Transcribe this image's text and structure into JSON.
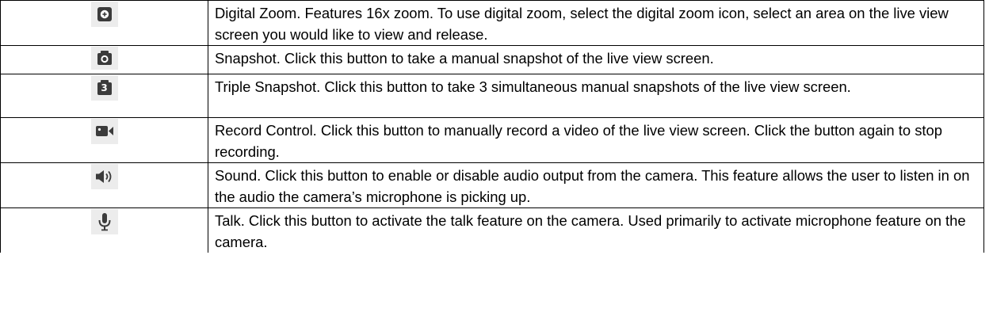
{
  "rows": [
    {
      "icon": "digital-zoom-icon",
      "description": "Digital Zoom. Features 16x zoom. To use digital zoom, select the digital zoom icon, select an area on the live view screen you would like to view and release."
    },
    {
      "icon": "camera-icon",
      "description": "Snapshot. Click this button to take a manual snapshot of the live view screen."
    },
    {
      "icon": "triple-snapshot-icon",
      "icon_label": "3",
      "description": "Triple Snapshot. Click this button to take 3 simultaneous manual snapshots of the live view screen."
    },
    {
      "icon": "video-camera-icon",
      "description": "Record Control. Click this button to manually record a video of the live view screen. Click the button again to stop recording."
    },
    {
      "icon": "speaker-icon",
      "description": "Sound. Click this button to enable or disable audio output from the camera. This feature allows the user to listen in on the audio the camera’s microphone is picking up."
    },
    {
      "icon": "microphone-icon",
      "description": "Talk. Click this button to activate the talk feature on the camera. Used primarily to activate microphone feature on the camera."
    }
  ],
  "colors": {
    "icon_fill": "#3b3b3b",
    "icon_bg": "#ececec",
    "border": "#000000"
  }
}
